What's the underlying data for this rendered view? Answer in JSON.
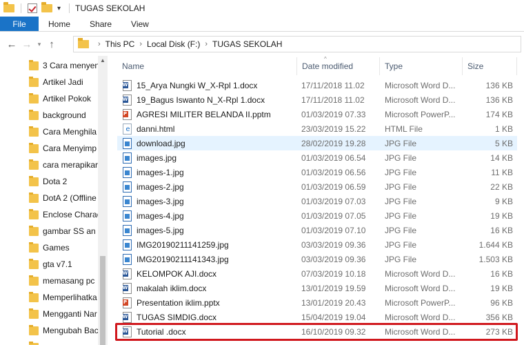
{
  "window": {
    "title": "TUGAS SEKOLAH"
  },
  "quick_access": {
    "dropdown_icon": "caret-down-icon"
  },
  "ribbon": {
    "file_tab": "File",
    "tabs": [
      "Home",
      "Share",
      "View"
    ],
    "file_tab_color": "#1a73c7"
  },
  "nav": {
    "back_icon": "arrow-left-icon",
    "forward_icon": "arrow-right-icon",
    "up_icon": "arrow-up-icon"
  },
  "breadcrumb": [
    "This PC",
    "Local Disk (F:)",
    "TUGAS SEKOLAH"
  ],
  "sidebar": {
    "items": [
      "3 Cara menyen",
      "Artikel Jadi",
      "Artikel Pokok",
      "background",
      "Cara Menghila",
      "Cara Menyimp",
      "cara merapikar",
      "Dota 2",
      "DotA 2 (Offline",
      "Enclose Charac",
      "gambar SS an",
      "Games",
      "gta v7.1",
      "memasang pc",
      "Memperlihatka",
      "Mengganti Nar",
      "Mengubah Bac",
      "c"
    ]
  },
  "columns": {
    "name": "Name",
    "date": "Date modified",
    "type": "Type",
    "size": "Size"
  },
  "files": [
    {
      "name": "15_Arya Nungki W_X-Rpl 1.docx",
      "date": "17/11/2018 11.02",
      "type": "Microsoft Word D...",
      "size": "136 KB",
      "icon": "word"
    },
    {
      "name": "19_Bagus Iswanto N_X-Rpl 1.docx",
      "date": "17/11/2018 11.02",
      "type": "Microsoft Word D...",
      "size": "136 KB",
      "icon": "word"
    },
    {
      "name": "AGRESI MILITER BELANDA II.pptm",
      "date": "01/03/2019 07.33",
      "type": "Microsoft PowerP...",
      "size": "174 KB",
      "icon": "ppt"
    },
    {
      "name": "danni.html",
      "date": "23/03/2019 15.22",
      "type": "HTML File",
      "size": "1 KB",
      "icon": "html"
    },
    {
      "name": "download.jpg",
      "date": "28/02/2019 19.28",
      "type": "JPG File",
      "size": "5 KB",
      "icon": "jpg"
    },
    {
      "name": "images.jpg",
      "date": "01/03/2019 06.54",
      "type": "JPG File",
      "size": "14 KB",
      "icon": "jpg"
    },
    {
      "name": "images-1.jpg",
      "date": "01/03/2019 06.56",
      "type": "JPG File",
      "size": "11 KB",
      "icon": "jpg"
    },
    {
      "name": "images-2.jpg",
      "date": "01/03/2019 06.59",
      "type": "JPG File",
      "size": "22 KB",
      "icon": "jpg"
    },
    {
      "name": "images-3.jpg",
      "date": "01/03/2019 07.03",
      "type": "JPG File",
      "size": "9 KB",
      "icon": "jpg"
    },
    {
      "name": "images-4.jpg",
      "date": "01/03/2019 07.05",
      "type": "JPG File",
      "size": "19 KB",
      "icon": "jpg"
    },
    {
      "name": "images-5.jpg",
      "date": "01/03/2019 07.10",
      "type": "JPG File",
      "size": "16 KB",
      "icon": "jpg"
    },
    {
      "name": "IMG20190211141259.jpg",
      "date": "03/03/2019 09.36",
      "type": "JPG File",
      "size": "1.644 KB",
      "icon": "jpg"
    },
    {
      "name": "IMG20190211141343.jpg",
      "date": "03/03/2019 09.36",
      "type": "JPG File",
      "size": "1.503 KB",
      "icon": "jpg"
    },
    {
      "name": "KELOMPOK AJI.docx",
      "date": "07/03/2019 10.18",
      "type": "Microsoft Word D...",
      "size": "16 KB",
      "icon": "word"
    },
    {
      "name": "makalah iklim.docx",
      "date": "13/01/2019 19.59",
      "type": "Microsoft Word D...",
      "size": "19 KB",
      "icon": "word"
    },
    {
      "name": "Presentation iklim.pptx",
      "date": "13/01/2019 20.43",
      "type": "Microsoft PowerP...",
      "size": "96 KB",
      "icon": "ppt"
    },
    {
      "name": "TUGAS SIMDIG.docx",
      "date": "15/04/2019 19.04",
      "type": "Microsoft Word D...",
      "size": "356 KB",
      "icon": "word"
    },
    {
      "name": "Tutorial .docx",
      "date": "16/10/2019 09.32",
      "type": "Microsoft Word D...",
      "size": "273 KB",
      "icon": "word"
    }
  ],
  "hover_row": "download.jpg",
  "highlight_row": "Tutorial .docx",
  "highlight_color": "#d0171d"
}
